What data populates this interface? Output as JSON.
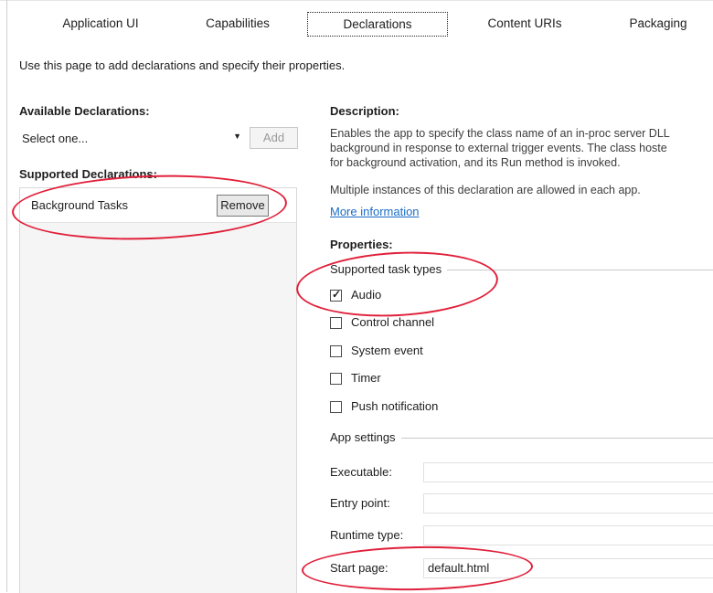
{
  "tabs": [
    {
      "label": "Application UI"
    },
    {
      "label": "Capabilities"
    },
    {
      "label": "Declarations"
    },
    {
      "label": "Content URIs"
    },
    {
      "label": "Packaging"
    }
  ],
  "intro_text": "Use this page to add declarations and specify their properties.",
  "available": {
    "heading": "Available Declarations:",
    "selected": "Select one...",
    "add_label": "Add"
  },
  "supported": {
    "heading": "Supported Declarations:",
    "items": [
      {
        "label": "Background Tasks",
        "remove_label": "Remove"
      }
    ]
  },
  "description": {
    "heading": "Description:",
    "lines": [
      "Enables the app to specify the class name of an in-proc server DLL",
      "background in response to external trigger events. The class hoste",
      "for background activation, and its Run method is invoked."
    ],
    "multiple_text": "Multiple instances of this declaration are allowed in each app.",
    "more_info": "More information"
  },
  "properties": {
    "heading": "Properties:",
    "task_types_label": "Supported task types",
    "task_types": [
      {
        "label": "Audio",
        "checked": true
      },
      {
        "label": "Control channel",
        "checked": false
      },
      {
        "label": "System event",
        "checked": false
      },
      {
        "label": "Timer",
        "checked": false
      },
      {
        "label": "Push notification",
        "checked": false
      }
    ],
    "app_settings_label": "App settings",
    "fields": [
      {
        "label": "Executable:",
        "value": ""
      },
      {
        "label": "Entry point:",
        "value": ""
      },
      {
        "label": "Runtime type:",
        "value": ""
      },
      {
        "label": "Start page:",
        "value": "default.html"
      }
    ]
  },
  "colors": {
    "annotation": "#e0203a",
    "link": "#1b6dc7"
  }
}
